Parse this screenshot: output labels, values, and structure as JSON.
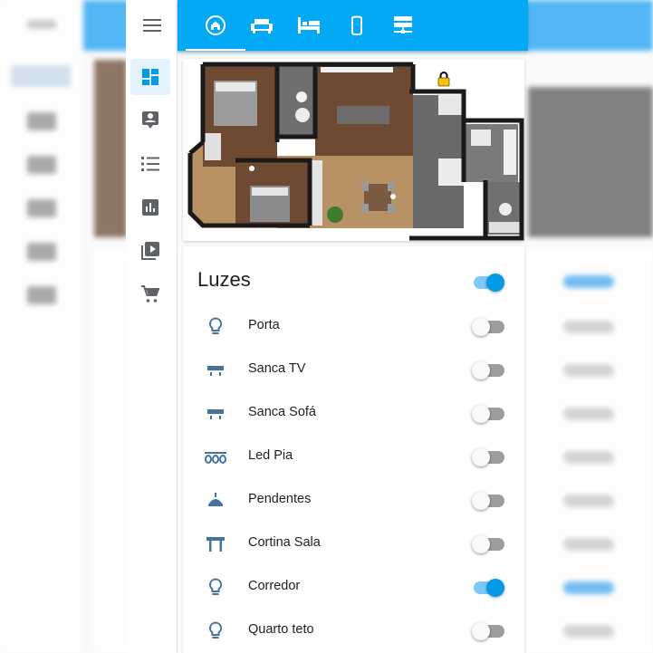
{
  "app": {
    "accent_color": "#03a9f4",
    "header_tabs": [
      {
        "icon": "home-icon",
        "active": true
      },
      {
        "icon": "sofa-icon",
        "active": false
      },
      {
        "icon": "bed-icon",
        "active": false
      },
      {
        "icon": "speaker-icon",
        "active": false
      },
      {
        "icon": "server-icon",
        "active": false
      }
    ],
    "sidebar_items": [
      {
        "icon": "menu-icon"
      },
      {
        "icon": "dashboard-icon",
        "active": true
      },
      {
        "icon": "account-box-icon"
      },
      {
        "icon": "logbook-list-icon"
      },
      {
        "icon": "history-chart-icon"
      },
      {
        "icon": "media-browser-icon"
      },
      {
        "icon": "shopping-cart-icon"
      }
    ]
  },
  "floorplan": {
    "lock_icon": "lock-icon"
  },
  "lights": {
    "title": "Luzes",
    "master_on": true,
    "items": [
      {
        "label": "Porta",
        "icon": "lightbulb-icon",
        "on": false
      },
      {
        "label": "Sanca TV",
        "icon": "ceiling-light-icon",
        "on": false
      },
      {
        "label": "Sanca Sofá",
        "icon": "ceiling-light-icon",
        "on": false
      },
      {
        "label": "Led Pia",
        "icon": "led-strip-icon",
        "on": false
      },
      {
        "label": "Pendentes",
        "icon": "pendant-light-icon",
        "on": false
      },
      {
        "label": "Cortina Sala",
        "icon": "curtain-rod-icon",
        "on": false
      },
      {
        "label": "Corredor",
        "icon": "lightbulb-icon",
        "on": true
      },
      {
        "label": "Quarto teto",
        "icon": "lightbulb-icon",
        "on": false
      }
    ]
  }
}
